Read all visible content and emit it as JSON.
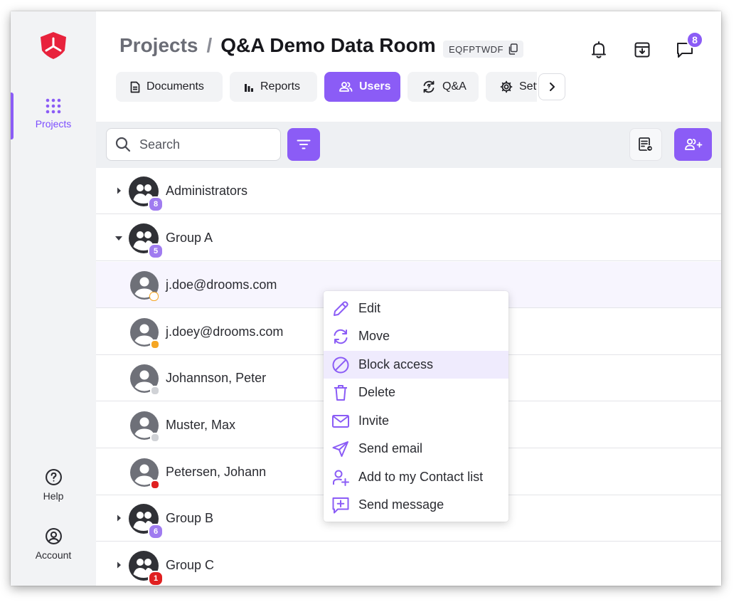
{
  "sidebar": {
    "projects_label": "Projects",
    "help_label": "Help",
    "account_label": "Account"
  },
  "header": {
    "breadcrumb_parent": "Projects",
    "breadcrumb_separator": "/",
    "room_title": "Q&A Demo Data Room",
    "room_code": "EQFPTWDF",
    "messages_badge": "8"
  },
  "tabs": [
    {
      "label": "Documents",
      "icon": "document-icon"
    },
    {
      "label": "Reports",
      "icon": "bar-chart-icon"
    },
    {
      "label": "Users",
      "icon": "users-icon",
      "active": true
    },
    {
      "label": "Q&A",
      "icon": "qa-icon"
    },
    {
      "label": "Settings",
      "icon": "gear-icon"
    }
  ],
  "toolbar": {
    "search_placeholder": "Search"
  },
  "rows": [
    {
      "type": "group",
      "name": "Administrators",
      "count": "8",
      "expanded": false
    },
    {
      "type": "group",
      "name": "Group A",
      "count": "5",
      "expanded": true
    },
    {
      "type": "user",
      "name": "j.doe@drooms.com",
      "status": "pending"
    },
    {
      "type": "user",
      "name": "j.doey@drooms.com",
      "status": "away"
    },
    {
      "type": "user",
      "name": "Johannson, Peter",
      "status": "offline"
    },
    {
      "type": "user",
      "name": "Muster, Max",
      "status": "offline"
    },
    {
      "type": "user",
      "name": "Petersen, Johann",
      "status": "blocked"
    },
    {
      "type": "group",
      "name": "Group B",
      "count": "6",
      "expanded": false
    },
    {
      "type": "group",
      "name": "Group C",
      "count": "1",
      "expanded": false
    }
  ],
  "context_menu": [
    {
      "label": "Edit",
      "icon": "pencil-icon"
    },
    {
      "label": "Move",
      "icon": "move-icon"
    },
    {
      "label": "Block access",
      "icon": "block-icon",
      "highlighted": true
    },
    {
      "label": "Delete",
      "icon": "trash-icon"
    },
    {
      "label": "Invite",
      "icon": "envelope-icon"
    },
    {
      "label": "Send email",
      "icon": "send-icon"
    },
    {
      "label": "Add to my Contact list",
      "icon": "add-contact-icon"
    },
    {
      "label": "Send message",
      "icon": "message-plus-icon"
    }
  ],
  "colors": {
    "accent": "#8b5cf6",
    "brand_red": "#e8223c",
    "status_pending": "#f5a623",
    "status_away": "#f5a623",
    "status_offline": "#d0d2d6",
    "status_blocked": "#e02020",
    "group_badge_alert": "#e02020"
  }
}
